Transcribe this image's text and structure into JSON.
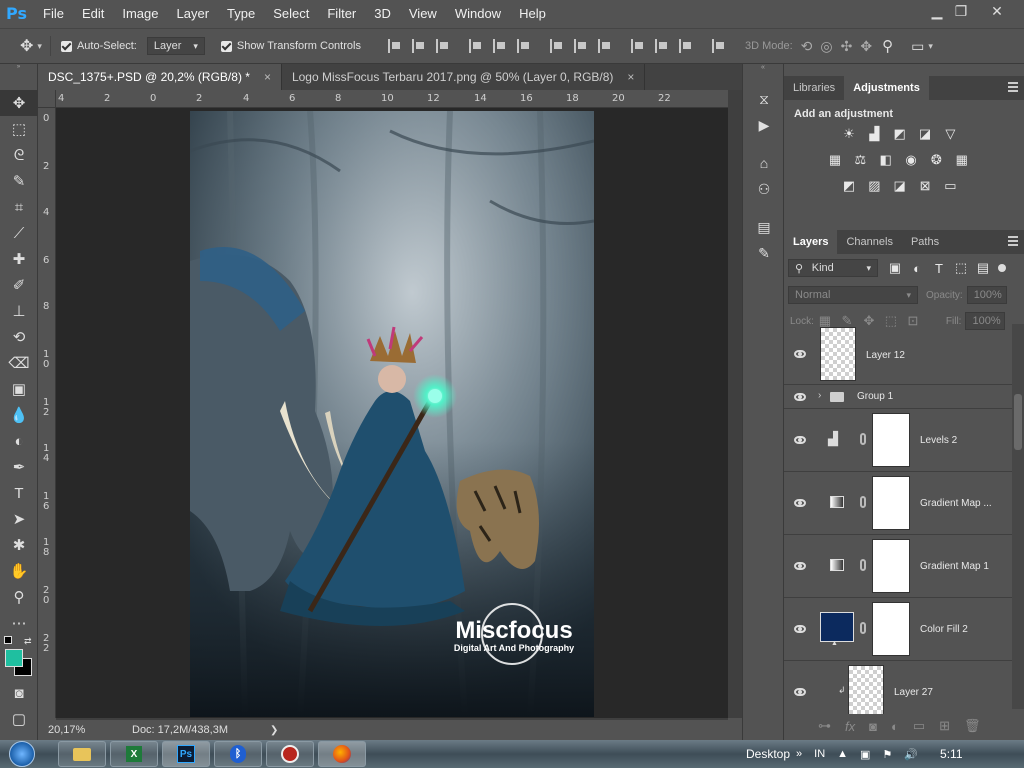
{
  "app": {
    "logo": "Ps"
  },
  "menu": [
    "File",
    "Edit",
    "Image",
    "Layer",
    "Type",
    "Select",
    "Filter",
    "3D",
    "View",
    "Window",
    "Help"
  ],
  "window_controls": {
    "minimize": "▁",
    "restore": "❐",
    "close": "✕"
  },
  "options_bar": {
    "auto_select_label": "Auto-Select:",
    "auto_select_value": "Layer",
    "transform_label": "Show Transform Controls",
    "mode_3d_label": "3D Mode:"
  },
  "tabs": [
    {
      "label": "DSC_1375+.PSD @ 20,2% (RGB/8) *",
      "close": "×"
    },
    {
      "label": "Logo MissFocus Terbaru 2017.png @ 50% (Layer 0, RGB/8)",
      "close": "×"
    }
  ],
  "ruler_top": [
    "4",
    "2",
    "0",
    "2",
    "4",
    "6",
    "8",
    "10",
    "12",
    "14",
    "16",
    "18",
    "20",
    "22"
  ],
  "ruler_left": [
    "0",
    "2",
    "4",
    "6",
    "8",
    "1 0",
    "1 2",
    "1 4",
    "1 6",
    "1 8",
    "2 0",
    "2 2"
  ],
  "canvas": {
    "watermark_title": "Miscfocus",
    "watermark_subtitle": "Digital Art And Photography"
  },
  "status": {
    "zoom": "20,17%",
    "doc": "Doc: 17,2M/438,3M",
    "arrow": "❯"
  },
  "panels": {
    "top_tabs": [
      "Libraries",
      "Adjustments"
    ],
    "add_adjustment": "Add an adjustment",
    "layer_tabs": [
      "Layers",
      "Channels",
      "Paths"
    ],
    "kind_label": "Kind",
    "blend_mode": "Normal",
    "opacity_label": "Opacity:",
    "opacity_value": "100%",
    "lock_label": "Lock:",
    "fill_label": "Fill:",
    "fill_value": "100%",
    "layers": [
      {
        "name": "Layer 12"
      },
      {
        "name": "Group 1"
      },
      {
        "name": "Levels 2"
      },
      {
        "name": "Gradient Map ..."
      },
      {
        "name": "Gradient Map 1"
      },
      {
        "name": "Color Fill 2"
      },
      {
        "name": "Layer 27"
      }
    ]
  },
  "taskbar": {
    "desktop_label": "Desktop",
    "lang": "IN",
    "time": "5:11",
    "ps_label": "Ps"
  },
  "colors": {
    "foreground": "#1fbfa0",
    "background": "#000000",
    "color_fill_swatch": "#0c2a5e"
  }
}
